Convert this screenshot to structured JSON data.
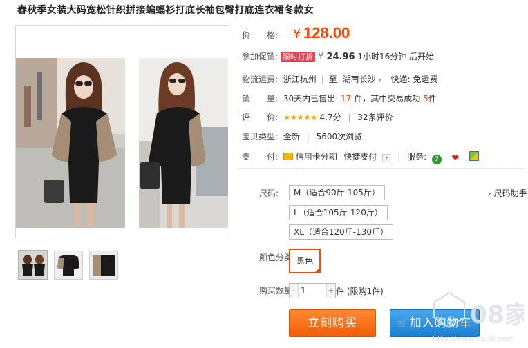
{
  "product": {
    "title": "春秋季女装大码宽松针织拼接蝙蝠衫打底长袖包臀打底连衣裙冬款女"
  },
  "price": {
    "label": "价　　格:",
    "currency": "¥",
    "value": "128.00"
  },
  "promo": {
    "label": "参加促销:",
    "tag": "限时打折",
    "currency": "¥",
    "value": "24.96",
    "countdown": "1小时16分钟 后开始"
  },
  "shipping": {
    "label": "物流运费:",
    "from": "浙江杭州",
    "to_label": "至",
    "to": "湖南长沙",
    "express": "快递: 免运费"
  },
  "sales": {
    "label": "销　　量:",
    "prefix": "30天内已售出",
    "sold": "17",
    "middle": "件，其中交易成功",
    "success": "5",
    "suffix": "件"
  },
  "rating": {
    "label": "评　　价:",
    "stars": "★★★★★",
    "score": "4.7分",
    "reviews": "32条评价"
  },
  "item_type": {
    "label": "宝贝类型:",
    "condition": "全新",
    "views": "5600次浏览"
  },
  "payment": {
    "label": "支　　付:",
    "credit": "信用卡分期",
    "quick": "快捷支付",
    "service_label": "服务:",
    "service_icons": [
      "seven-day-return-icon",
      "guarantee-icon",
      "certified-icon"
    ]
  },
  "size": {
    "label": "尺码:",
    "options": [
      "M（适合90斤-105斤）",
      "L（适合105斤-120斤）",
      "XL（适合120斤-130斤）"
    ],
    "assistant": "尺码助手"
  },
  "color": {
    "label": "颜色分类:",
    "selected": "黑色"
  },
  "quantity": {
    "label": "购买数量:",
    "minus": "-",
    "plus": "+",
    "value": "1",
    "unit": "件 (限购1件)"
  },
  "actions": {
    "buy": "立刻购买",
    "cart": "加入购物车"
  },
  "watermark": {
    "text": "08家",
    "url": "http://www.0E08.com"
  },
  "colors": {
    "accent": "#ff4400",
    "buy": "#f25c08",
    "cart": "#1b7fd1",
    "promo_tag": "#e8404a",
    "stars": "#f2a300"
  }
}
